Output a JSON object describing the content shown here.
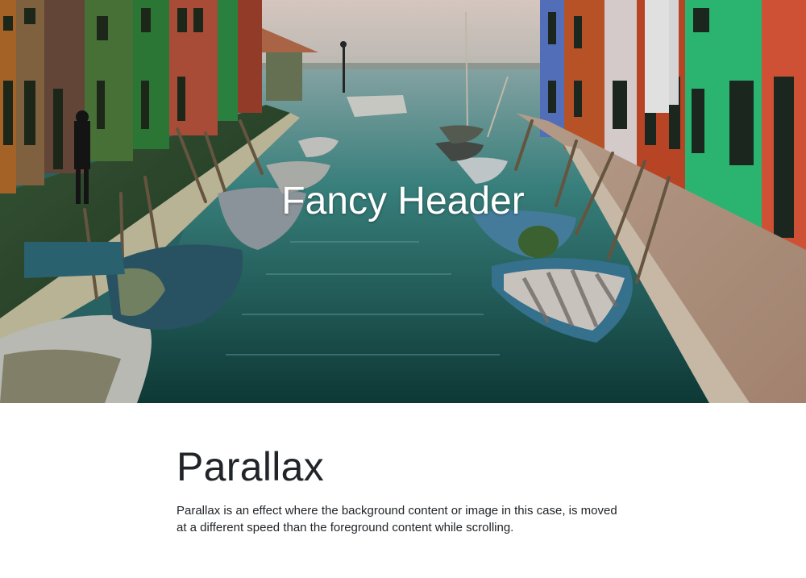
{
  "hero": {
    "title": "Fancy Header",
    "image_description_icon": "venice-canal-photo"
  },
  "content": {
    "heading": "Parallax",
    "paragraph": "Parallax is an effect where the background content or image in this case, is moved at a different speed than the foreground content while scrolling."
  },
  "colors": {
    "page_background": "#ffffff",
    "text": "#212529",
    "hero_text": "#ffffff",
    "water": "#2f7a7a",
    "sky": "#e9dcd2"
  }
}
